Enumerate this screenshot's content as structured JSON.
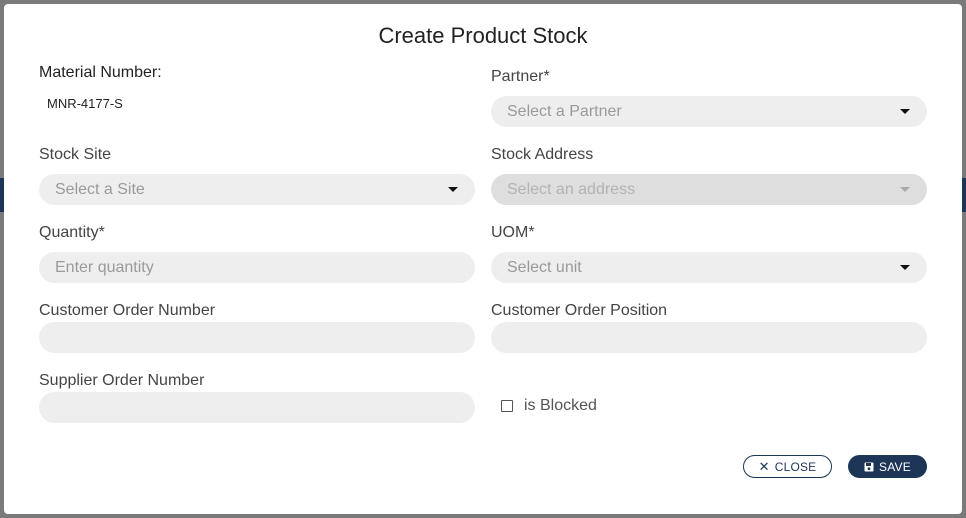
{
  "dialog": {
    "title": "Create Product Stock",
    "material_number": {
      "label": "Material Number:",
      "value": "MNR-4177-S"
    },
    "partner": {
      "label": "Partner*",
      "placeholder": "Select a Partner"
    },
    "stock_site": {
      "label": "Stock Site",
      "placeholder": "Select a Site"
    },
    "stock_address": {
      "label": "Stock Address",
      "placeholder": "Select an address",
      "disabled": true
    },
    "quantity": {
      "label": "Quantity*",
      "placeholder": "Enter quantity"
    },
    "uom": {
      "label": "UOM*",
      "placeholder": "Select unit"
    },
    "customer_order_number": {
      "label": "Customer Order Number",
      "value": ""
    },
    "customer_order_position": {
      "label": "Customer Order Position",
      "value": ""
    },
    "supplier_order_number": {
      "label": "Supplier Order Number",
      "value": ""
    },
    "is_blocked": {
      "label": "is Blocked",
      "checked": false
    },
    "buttons": {
      "close_label": "CLOSE",
      "save_label": "SAVE"
    }
  },
  "icons": {
    "close": "close-icon",
    "save": "floppy-disk-icon",
    "dropdown": "chevron-down-icon"
  },
  "colors": {
    "primary": "#1d3557",
    "field_background": "#eeeeee",
    "disabled_field_background": "#dedede"
  }
}
